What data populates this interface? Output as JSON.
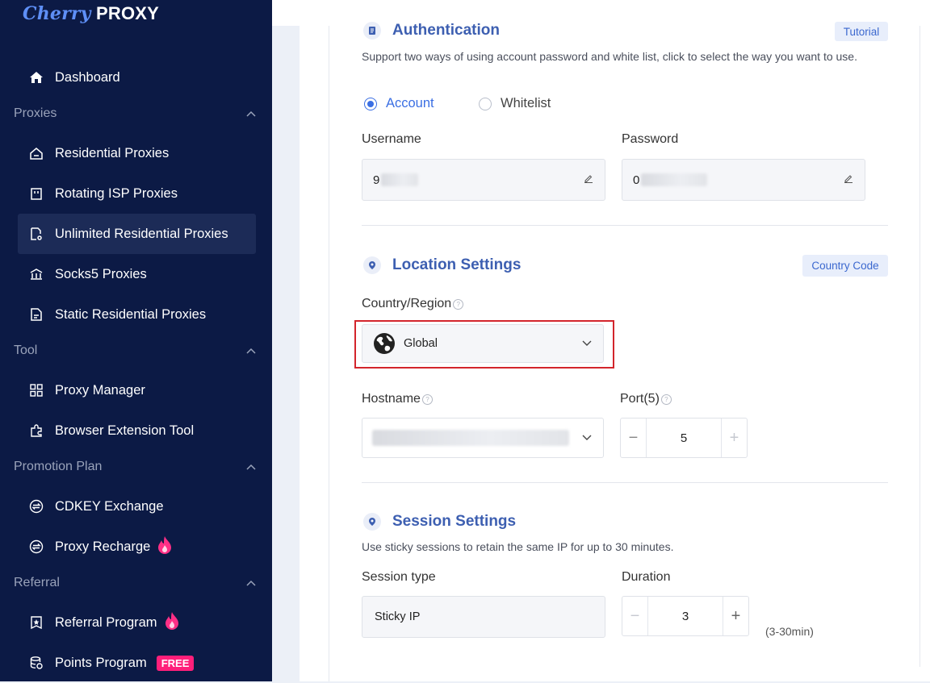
{
  "brand": {
    "part1": "Cherry",
    "part2": "PROXY"
  },
  "sidebar": {
    "dashboard": "Dashboard",
    "sections": {
      "proxies": "Proxies",
      "tool": "Tool",
      "promotion": "Promotion Plan",
      "referral": "Referral"
    },
    "items": {
      "residential": "Residential Proxies",
      "rotating_isp": "Rotating ISP Proxies",
      "unlimited": "Unlimited Residential Proxies",
      "socks5": "Socks5 Proxies",
      "static": "Static Residential Proxies",
      "proxy_manager": "Proxy Manager",
      "browser_ext": "Browser Extension Tool",
      "cdkey": "CDKEY Exchange",
      "recharge": "Proxy Recharge",
      "referral_program": "Referral Program",
      "points_program": "Points Program",
      "free_badge": "FREE"
    },
    "active_item": "unlimited"
  },
  "auth": {
    "title": "Authentication",
    "tutorial": "Tutorial",
    "description": "Support two ways of using account password and white list, click to select the way you want to use.",
    "options": [
      "Account",
      "Whitelist"
    ],
    "selected": "Account",
    "username_label": "Username",
    "password_label": "Password",
    "username_value": "9",
    "password_value": "0"
  },
  "location": {
    "title": "Location Settings",
    "country_code_btn": "Country Code",
    "country_label": "Country/Region",
    "country_value": "Global",
    "hostname_label": "Hostname",
    "port_label": "Port(5)",
    "port_value": "5"
  },
  "session": {
    "title": "Session Settings",
    "description": "Use sticky sessions to retain the same IP for up to 30 minutes.",
    "type_label": "Session type",
    "type_value": "Sticky IP",
    "duration_label": "Duration",
    "duration_value": "3",
    "duration_hint": "(3-30min)"
  },
  "colors": {
    "sidebar_bg": "#0c1a45",
    "accent": "#3b6fe3",
    "highlight_border": "#d3252c",
    "badge": "#ff1f7a"
  }
}
